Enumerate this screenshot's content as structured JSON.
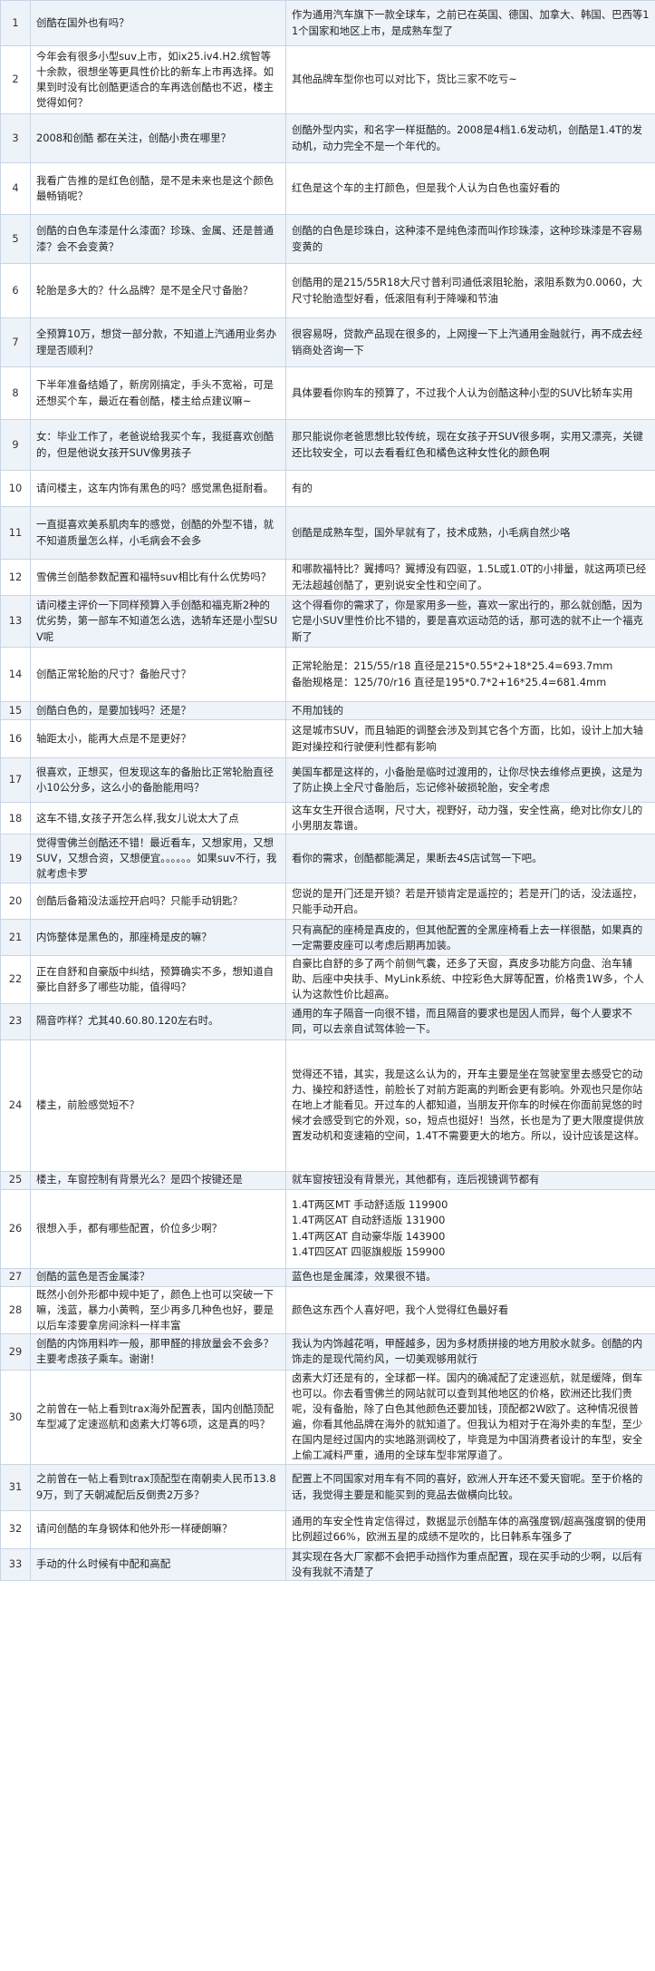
{
  "faq": [
    {
      "num": "1",
      "q": "创酷在国外也有吗？",
      "a": "作为通用汽车旗下一款全球车，之前已在英国、德国、加拿大、韩国、巴西等11个国家和地区上市，是成熟车型了"
    },
    {
      "num": "2",
      "q": "今年会有很多小型suv上市，如ix25.iv4.H2.缤智等十余款，很想坐等更具性价比的新车上市再选择。如果到时没有比创酷更适合的车再选创酷也不迟，楼主觉得如何？",
      "a": "其他品牌车型你也可以对比下，货比三家不吃亏~"
    },
    {
      "num": "3",
      "q": "2008和创酷 都在关注，创酷小贵在哪里？",
      "a": "创酷外型内实，和名字一样挺酷的。2008是4档1.6发动机，创酷是1.4T的发动机，动力完全不是一个年代的。"
    },
    {
      "num": "4",
      "q": "我看广告推的是红色创酷，是不是未来也是这个颜色最畅销呢？",
      "a": "红色是这个车的主打颜色，但是我个人认为白色也蛮好看的"
    },
    {
      "num": "5",
      "q": "创酷的白色车漆是什么漆面？珍珠、金属、还是普通漆？会不会变黄？",
      "a": "创酷的白色是珍珠白，这种漆不是纯色漆而叫作珍珠漆，这种珍珠漆是不容易变黄的"
    },
    {
      "num": "6",
      "q": "轮胎是多大的？什么品牌？是不是全尺寸备胎？",
      "a": "创酷用的是215/55R18大尺寸普利司通低滚阻轮胎，滚阻系数为0.0060，大尺寸轮胎造型好看，低滚阻有利于降噪和节油"
    },
    {
      "num": "7",
      "q": "全预算10万，想贷一部分款，不知道上汽通用业务办理是否顺利？",
      "a": "很容易呀，贷款产品现在很多的，上网搜一下上汽通用金融就行，再不成去经销商处咨询一下"
    },
    {
      "num": "8",
      "q": "下半年准备结婚了，新房刚搞定，手头不宽裕，可是还想买个车，最近在看创酷，楼主给点建议嘛~",
      "a": "具体要看你购车的预算了，不过我个人认为创酷这种小型的SUV比轿车实用"
    },
    {
      "num": "9",
      "q": "女：毕业工作了，老爸说给我买个车，我挺喜欢创酷的，但是他说女孩开SUV像男孩子",
      "a": "那只能说你老爸思想比较传统，现在女孩子开SUV很多啊，实用又漂亮，关键还比较安全，可以去看看红色和橘色这种女性化的颜色啊"
    },
    {
      "num": "10",
      "q": "请问楼主，这车内饰有黑色的吗？感觉黑色挺耐看。",
      "a": "有的"
    },
    {
      "num": "11",
      "q": "一直挺喜欢美系肌肉车的感觉，创酷的外型不错，就不知道质量怎么样，小毛病会不会多",
      "a": "创酷是成熟车型，国外早就有了，技术成熟，小毛病自然少咯"
    },
    {
      "num": "12",
      "q": "雪佛兰创酷参数配置和福特suv相比有什么优势吗？",
      "a": "和哪款福特比？翼搏吗？翼搏没有四驱，1.5L或1.0T的小排量，就这两项已经无法超越创酷了，更别说安全性和空间了。"
    },
    {
      "num": "13",
      "q": "请问楼主评价一下同样预算入手创酷和福克斯2种的优劣势，第一部车不知道怎么选，选轿车还是小型SUV呢",
      "a": "这个得看你的需求了，你是家用多一些，喜欢一家出行的，那么就创酷，因为它是小SUV里性价比不错的，要是喜欢运动范的话，那可选的就不止一个福克斯了"
    },
    {
      "num": "14",
      "q": "创酷正常轮胎的尺寸？备胎尺寸？",
      "a": "正常轮胎是：215/55/r18 直径是215*0.55*2+18*25.4=693.7mm\n备胎规格是：125/70/r16 直径是195*0.7*2+16*25.4=681.4mm"
    },
    {
      "num": "15",
      "q": "创酷白色的，是要加钱吗？还是？",
      "a": "不用加钱的"
    },
    {
      "num": "16",
      "q": "轴距太小，能再大点是不是更好？",
      "a": "这是城市SUV，而且轴距的调整会涉及到其它各个方面，比如，设计上加大轴距对操控和行驶便利性都有影响"
    },
    {
      "num": "17",
      "q": "很喜欢，正想买，但发现这车的备胎比正常轮胎直径小10公分多，这么小的备胎能用吗？",
      "a": "美国车都是这样的，小备胎是临时过渡用的，让你尽快去维修点更换，这是为了防止换上全尺寸备胎后，忘记修补破损轮胎，安全考虑"
    },
    {
      "num": "18",
      "q": "这车不错,女孩子开怎么样,我女儿说太大了点",
      "a": "这车女生开很合适啊，尺寸大，视野好，动力强，安全性高，绝对比你女儿的小男朋友靠谱。"
    },
    {
      "num": "19",
      "q": "觉得雪佛兰创酷还不错！最近看车，又想家用，又想SUV，又想合资，又想便宜。。。。。。如果suv不行，我就考虑卡罗",
      "a": "看你的需求，创酷都能满足，果断去4S店试驾一下吧。"
    },
    {
      "num": "20",
      "q": "创酷后备箱没法遥控开启吗？只能手动钥匙？",
      "a": "您说的是开门还是开锁？若是开锁肯定是遥控的；若是开门的话，没法遥控，只能手动开启。"
    },
    {
      "num": "21",
      "q": "内饰整体是黑色的，那座椅是皮的嘛？",
      "a": "只有高配的座椅是真皮的，但其他配置的全黑座椅看上去一样很酷，如果真的一定需要皮座可以考虑后期再加装。"
    },
    {
      "num": "22",
      "q": "正在自舒和自豪版中纠结，预算确实不多，想知道自豪比自舒多了哪些功能，值得吗？",
      "a": "自豪比自舒的多了两个前侧气囊，还多了天窗，真皮多功能方向盘、治车辅助、后座中央扶手、MyLink系统、中控彩色大屏等配置，价格贵1W多，个人认为这款性价比超高。"
    },
    {
      "num": "23",
      "q": "隔音咋样？尤其40.60.80.120左右时。",
      "a": "通用的车子隔音一向很不错，而且隔音的要求也是因人而异，每个人要求不同，可以去亲自试驾体验一下。"
    },
    {
      "num": "24",
      "q": "楼主，前脸感觉短不？",
      "a": "觉得还不错，其实，我是这么认为的，开车主要是坐在驾驶室里去感受它的动力、操控和舒适性，前脸长了对前方距离的判断会更有影响。外观也只是你站在地上才能看见。开过车的人都知道，当朋友开你车的时候在你面前晃悠的时候才会感受到它的外观，so，短点也挺好！当然，长也是为了更大限度提供放置发动机和变速箱的空间，1.4T不需要更大的地方。所以，设计应该是这样。"
    },
    {
      "num": "25",
      "q": "楼主，车窗控制有背景光么？是四个按键还是",
      "a": "就车窗按钮没有背景光，其他都有，连后视镜调节都有"
    },
    {
      "num": "26",
      "q": "很想入手，都有哪些配置，价位多少啊？",
      "a": "1.4T两区MT 手动舒适版 119900\n1.4T两区AT 自动舒适版 131900\n1.4T两区AT 自动豪华版 143900\n1.4T四区AT 四驱旗舰版 159900"
    },
    {
      "num": "27",
      "q": "创酷的蓝色是否金属漆？",
      "a": "蓝色也是金属漆，效果很不错。"
    },
    {
      "num": "28",
      "q": "既然小创外形都中规中矩了，颜色上也可以突破一下嘛，浅蓝，暴力小黄鸭，至少再多几种色也好，要是以后车漆要拿房间涂料一样丰富",
      "a": "颜色这东西个人喜好吧，我个人觉得红色最好看"
    },
    {
      "num": "29",
      "q": "创酷的内饰用料咋一般，那甲醛的排放量会不会多？主要考虑孩子乘车。谢谢！",
      "a": "我认为内饰越花哨，甲醛越多，因为多材质拼接的地方用胶水就多。创酷的内饰走的是现代简约风，一切美观够用就行"
    },
    {
      "num": "30",
      "q": "之前曾在一帖上看到trax海外配置表，国内创酷顶配车型减了定速巡航和卤素大灯等6项，这是真的吗？",
      "a": "卤素大灯还是有的，全球都一样。国内的确减配了定速巡航，就是缓降，倒车也可以。你去看雪佛兰的网站就可以查到其他地区的价格，欧洲还比我们贵呢，没有备胎，除了白色其他颜色还要加钱，顶配都2W欧了。这种情况很普遍，你看其他品牌在海外的就知道了。但我认为相对于在海外卖的车型，至少在国内是经过国内的实地路测调校了，毕竟是为中国消费者设计的车型，安全上偷工减料严重，通用的全球车型非常厚道了。"
    },
    {
      "num": "31",
      "q": "之前曾在一帖上看到trax顶配型在南朝卖人民币13.89万，到了天朝减配后反倒贵2万多？",
      "a": "配置上不同国家对用车有不同的喜好，欧洲人开车还不爱天窗呢。至于价格的话，我觉得主要是和能买到的竞品去做横向比较。"
    },
    {
      "num": "32",
      "q": "请问创酷的车身钢体和他外形一样硬朗嘛？",
      "a": "通用的车安全性肯定信得过，数据显示创酷车体的高强度钢/超高强度钢的使用比例超过66%，欧洲五星的成绩不是吹的，比日韩系车强多了"
    },
    {
      "num": "33",
      "q": "手动的什么时候有中配和高配",
      "a": "其实现在各大厂家都不会把手动挡作为重点配置，现在买手动的少啊，以后有没有我就不清楚了"
    }
  ]
}
